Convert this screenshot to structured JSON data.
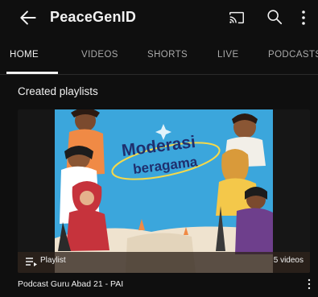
{
  "header": {
    "channel_name": "PeaceGenID",
    "icons": [
      "back-arrow-icon",
      "cast-icon",
      "search-icon",
      "more-vert-icon"
    ]
  },
  "tabs": [
    {
      "label": "HOME",
      "active": true
    },
    {
      "label": "VIDEOS",
      "active": false
    },
    {
      "label": "SHORTS",
      "active": false
    },
    {
      "label": "LIVE",
      "active": false
    },
    {
      "label": "PODCASTS",
      "active": false
    }
  ],
  "section": {
    "title": "Created playlists"
  },
  "playlist": {
    "thumbnail_text_line1": "Moderasi",
    "thumbnail_text_line2": "beragama",
    "badge_label": "Playlist",
    "video_count": "5 videos",
    "title": "Podcast Guru Abad 21 - PAI"
  },
  "colors": {
    "background": "#0f0f0f",
    "text": "#f1f1f1",
    "muted": "#aaaaaa",
    "thumb_sky": "#3ba6dc",
    "thumb_title": "#1f2f6e"
  }
}
